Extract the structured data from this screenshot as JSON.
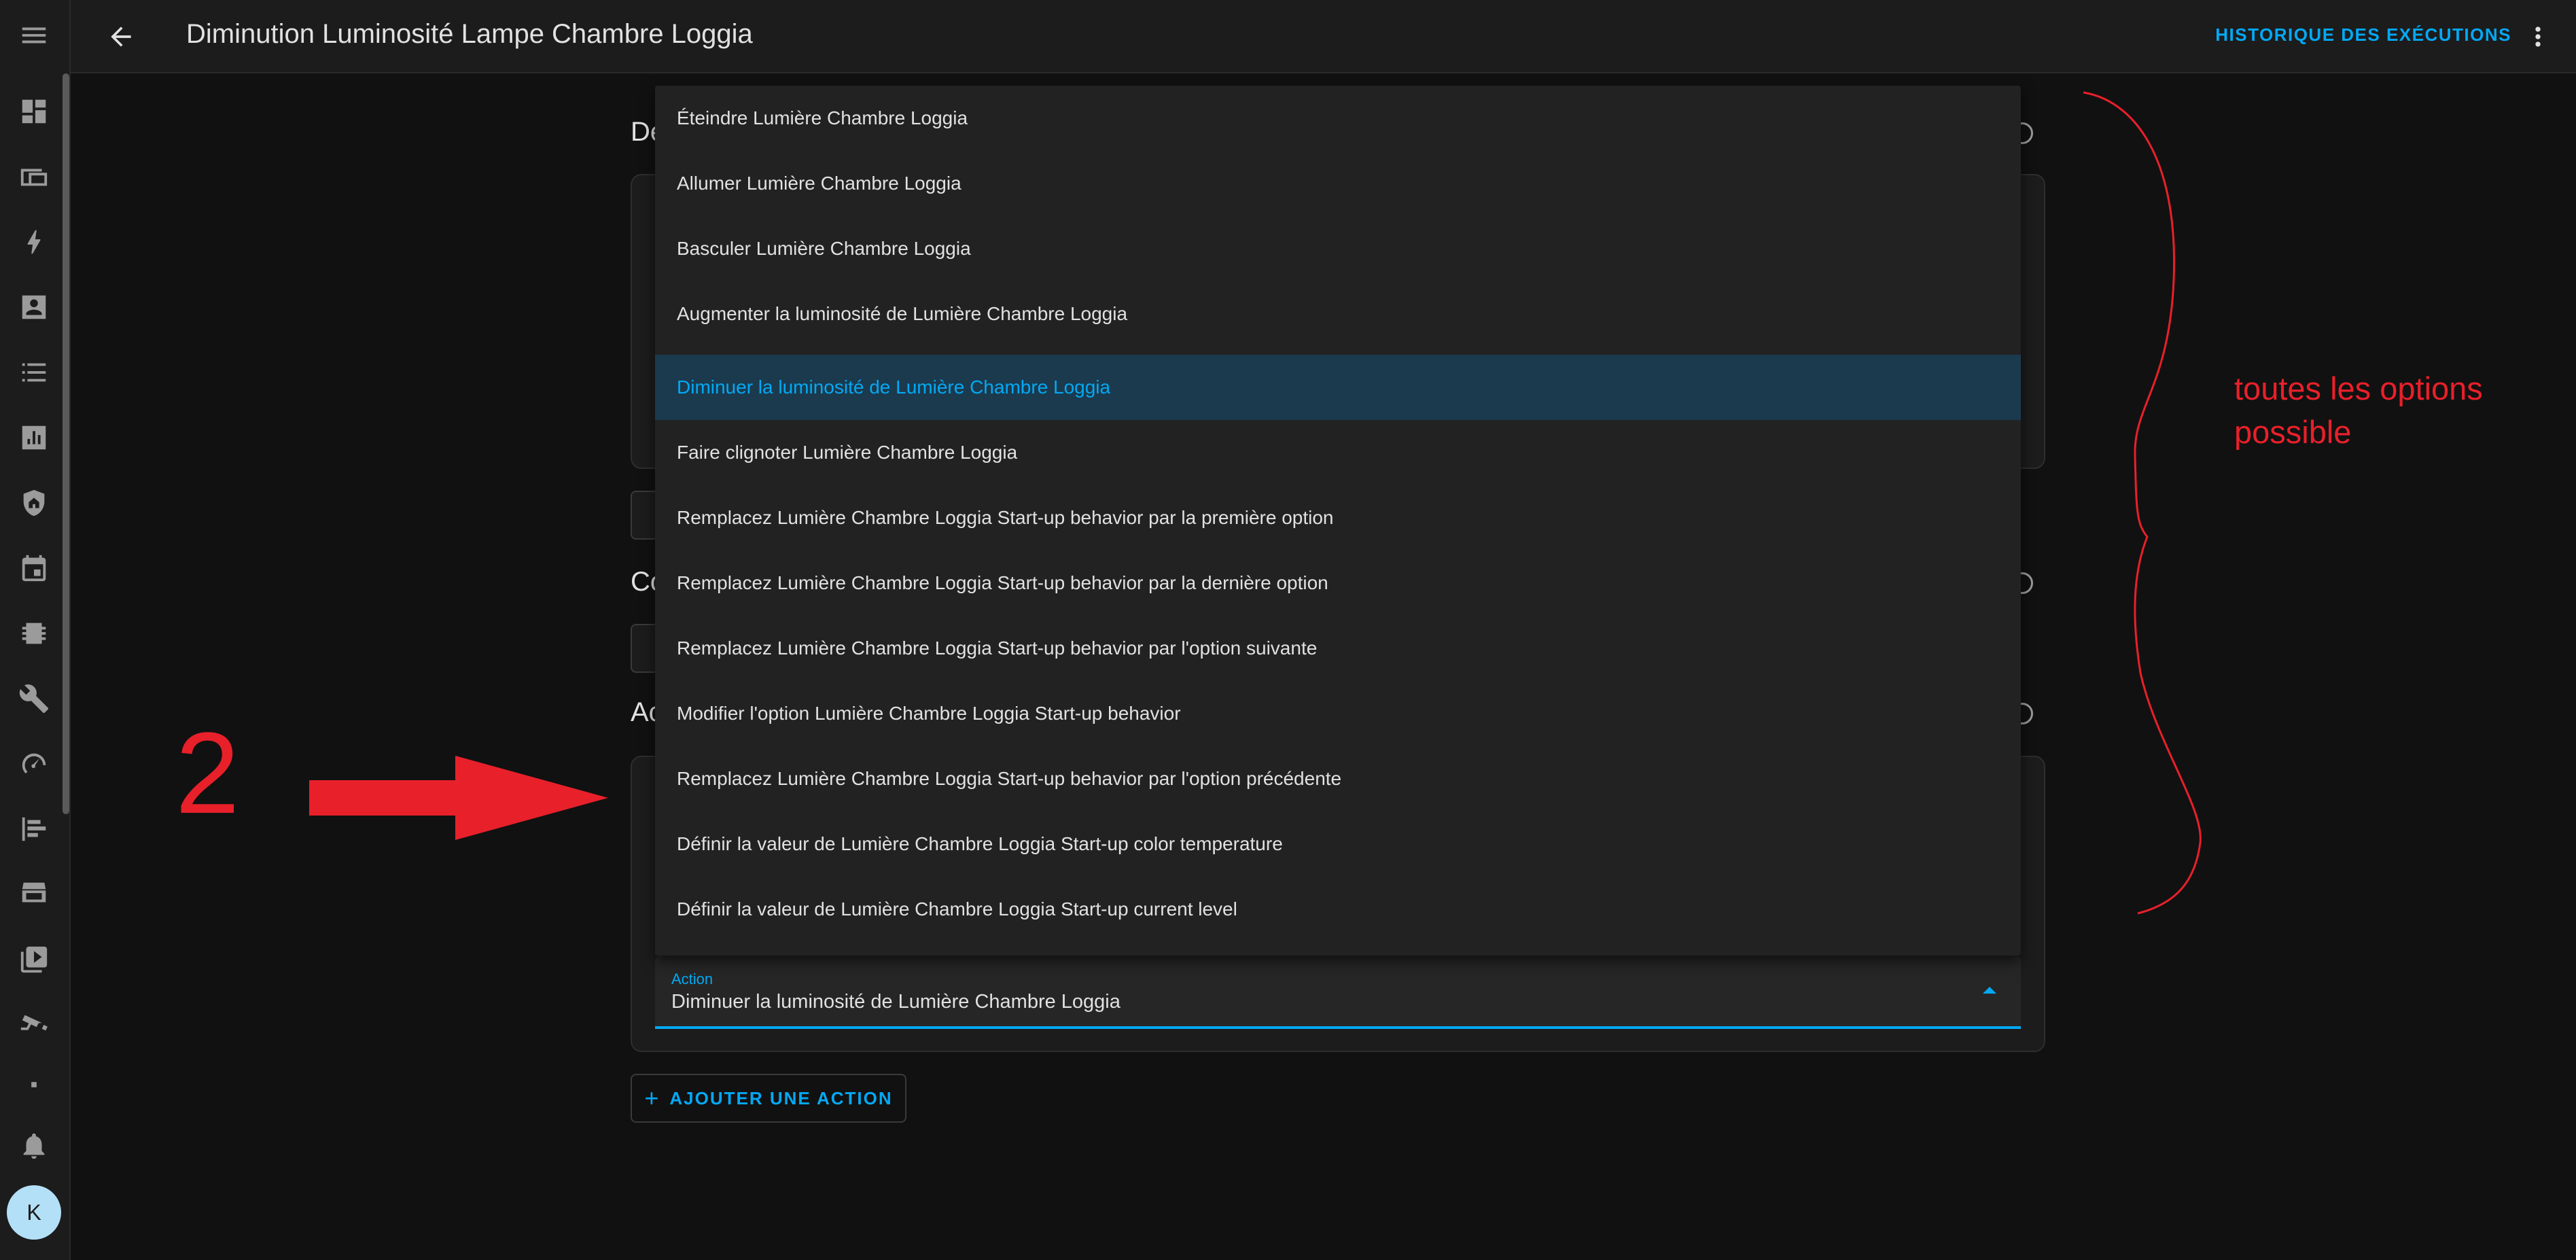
{
  "header": {
    "title": "Diminution Luminosité Lampe Chambre Loggia",
    "history_button": "HISTORIQUE DES EXÉCUTIONS"
  },
  "sidebar": {
    "items": [
      "menu-icon",
      "dashboard-icon",
      "devices-icon",
      "energy-icon",
      "map-icon",
      "logbook-icon",
      "history-icon",
      "security-icon",
      "calendar-icon",
      "integrations-icon",
      "developer-tools-icon",
      "speedometer-icon",
      "timeline-icon",
      "hacs-icon",
      "media-icon",
      "cctv-icon"
    ],
    "avatar_initial": "K"
  },
  "editor": {
    "section_1_fragment": "De",
    "section_2_fragment": "Co",
    "section_3_fragment": "Ac",
    "add_action_button": "AJOUTER UNE ACTION"
  },
  "action_field": {
    "label": "Action",
    "value": "Diminuer la luminosité de Lumière Chambre Loggia"
  },
  "dropdown": {
    "options": [
      "Éteindre Lumière Chambre Loggia",
      "Allumer Lumière Chambre Loggia",
      "Basculer Lumière Chambre Loggia",
      "Augmenter la luminosité de Lumière Chambre Loggia",
      "Diminuer la luminosité de Lumière Chambre Loggia",
      "Faire clignoter Lumière Chambre Loggia",
      "Remplacez Lumière Chambre Loggia Start-up behavior par la première option",
      "Remplacez Lumière Chambre Loggia Start-up behavior par la dernière option",
      "Remplacez Lumière Chambre Loggia Start-up behavior par l'option suivante",
      "Modifier l'option Lumière Chambre Loggia Start-up behavior",
      "Remplacez Lumière Chambre Loggia Start-up behavior par l'option précédente",
      "Définir la valeur de Lumière Chambre Loggia Start-up color temperature",
      "Définir la valeur de Lumière Chambre Loggia Start-up current level"
    ],
    "selected_index": 4
  },
  "annotations": {
    "number": "2",
    "note": "toutes les options possible",
    "color": "#e8202a"
  },
  "colors": {
    "accent": "#03a9f4",
    "background": "#111111",
    "surface": "#1c1c1c",
    "selected_bg": "#1b3a4e"
  }
}
